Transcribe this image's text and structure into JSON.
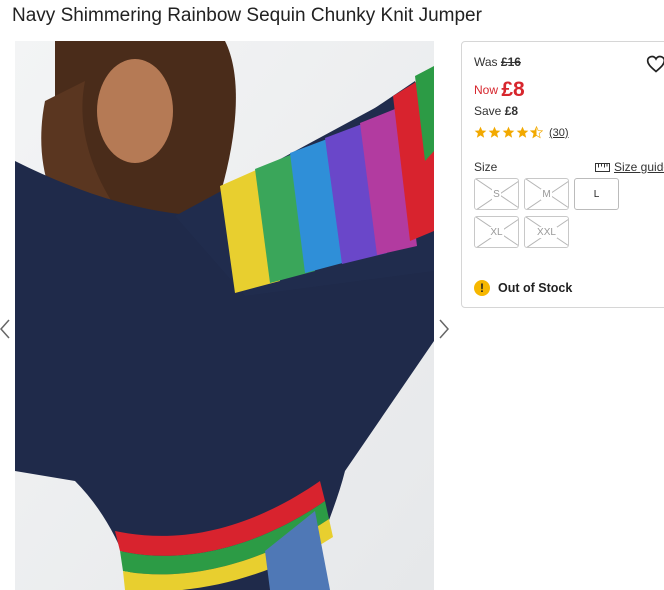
{
  "product": {
    "title": "Navy Shimmering Rainbow Sequin Chunky Knit Jumper"
  },
  "gallery": {
    "image_alt": "Model wearing navy chunky knit jumper with rainbow sequin sleeve stripes",
    "prev_icon": "chevron-left-icon",
    "next_icon": "chevron-right-icon"
  },
  "pricing": {
    "was_label": "Was",
    "was_price": "£16",
    "now_label": "Now",
    "now_price": "£8",
    "save_label": "Save",
    "save_amount": "£8"
  },
  "rating": {
    "stars": 4.5,
    "max": 5,
    "review_count": "(30)"
  },
  "sizes": {
    "label": "Size",
    "guide_label": "Size guide",
    "options": [
      {
        "label": "S",
        "available": false
      },
      {
        "label": "M",
        "available": false
      },
      {
        "label": "L",
        "available": true
      },
      {
        "label": "XL",
        "available": false
      },
      {
        "label": "XXL",
        "available": false
      }
    ]
  },
  "stock": {
    "status": "Out of Stock",
    "icon": "warning-icon"
  },
  "colors": {
    "price_red": "#d7262d",
    "warning_yellow": "#f6b700",
    "star_gold": "#f2a900",
    "navy": "#1f2a4a"
  }
}
